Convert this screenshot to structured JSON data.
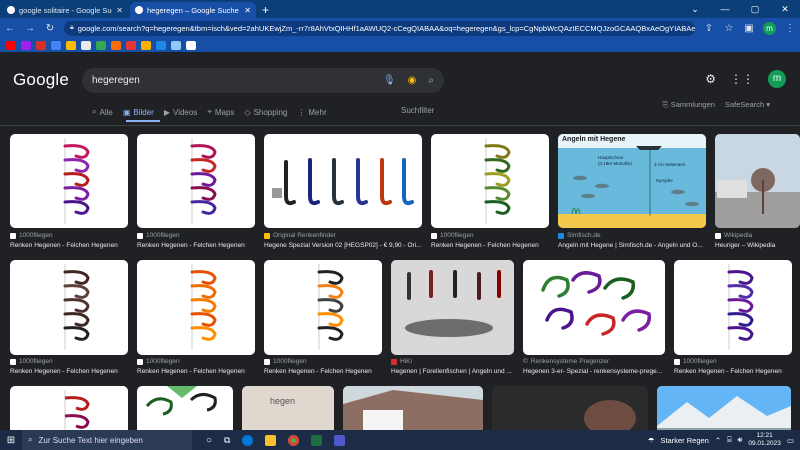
{
  "browser": {
    "tabs": [
      {
        "title": "google solitaire - Google Suche"
      },
      {
        "title": "hegeregen – Google Suche"
      }
    ],
    "url": "google.com/search?q=hegeregen&tbm=isch&ved=2ahUKEwjZm_-rr7r8AhVtxQIHHf1aAWUQ2-cCegQIABAA&oq=hegeregen&gs_lcp=CgNpbWcQAzIECCMQJzoGCAAQBxAeOgYIABAeOgYIA...",
    "profile_initial": "m"
  },
  "google": {
    "logo": "Google",
    "query": "hegeregen",
    "avatar_initial": "m",
    "nav": {
      "all": "Alle",
      "images": "Bilder",
      "videos": "Videos",
      "maps": "Maps",
      "shopping": "Shopping",
      "more": "Mehr",
      "filter": "Suchfilter",
      "collections": "Sammlungen",
      "safesearch": "SafeSearch"
    },
    "row1": [
      {
        "source": "1000fliegen",
        "caption": "Renken Hegenen - Felchen Hegenen"
      },
      {
        "source": "1000fliegen",
        "caption": "Renken Hegenen - Felchen Hegenen"
      },
      {
        "source": "Original Renkenfinder",
        "caption": "Hegene Spezial Version 02 [HEGSP02] - € 9,90 - Ori..."
      },
      {
        "source": "1000fliegen",
        "caption": "Renken Hegenen - Felchen Hegenen"
      },
      {
        "source": "Simfisch.de",
        "caption": "Angeln mit Hegene | Simfisch.de - Angeln und O..."
      },
      {
        "source": "Wikipedia",
        "caption": "Heuriger – Wikipedia"
      }
    ],
    "row2": [
      {
        "source": "1000fliegen",
        "caption": "Renken Hegenen - Felchen Hegenen"
      },
      {
        "source": "1000fliegen",
        "caption": "Renken Hegenen - Felchen Hegenen"
      },
      {
        "source": "1000fliegen",
        "caption": "Renken Hegenen - Felchen Hegenen"
      },
      {
        "source": "HiKi",
        "caption": "Hegenen | Forellenfischen | Angeln und ..."
      },
      {
        "source": "Renkensysteme Pregenzer",
        "caption": "Hegenen 3-er- Spezial - renkensysteme-prege..."
      },
      {
        "source": "1000fliegen",
        "caption": "Renken Hegenen - Felchen Hegenen"
      }
    ],
    "diagram": {
      "title": "Angeln mit Hegene",
      "label1": "Hauptschnur",
      "label1b": "(0,18er Monofile)",
      "label2": "3 cm Seitenarm",
      "label3": "Nymphe"
    },
    "partial_label": "hegen"
  },
  "taskbar": {
    "search_placeholder": "Zur Suche Text hier eingeben",
    "weather": "Starker Regen",
    "time": "12:21",
    "date": "09.01.2023"
  }
}
